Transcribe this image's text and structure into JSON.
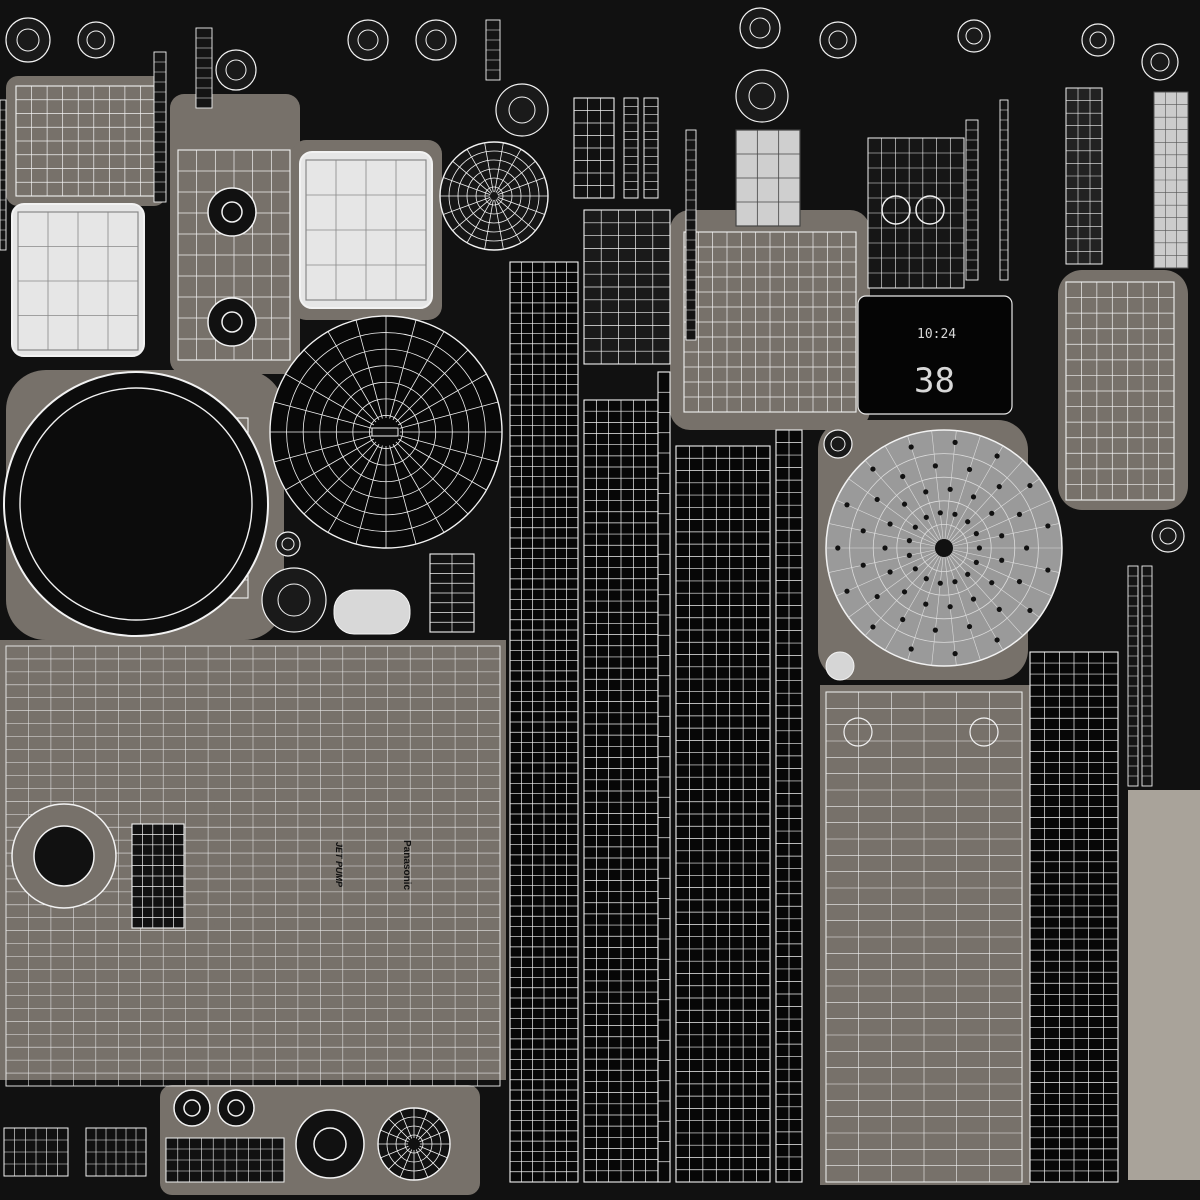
{
  "texture": {
    "brand": "Panasonic",
    "model": "JET PUMP",
    "display_big": "38",
    "display_small": "10:24"
  },
  "colors": {
    "background": "#111111",
    "island": "#77716a",
    "wire": "#f2f2f2",
    "light_panel": "#e6e6e6",
    "grey_disc": "#9a9a9a"
  }
}
